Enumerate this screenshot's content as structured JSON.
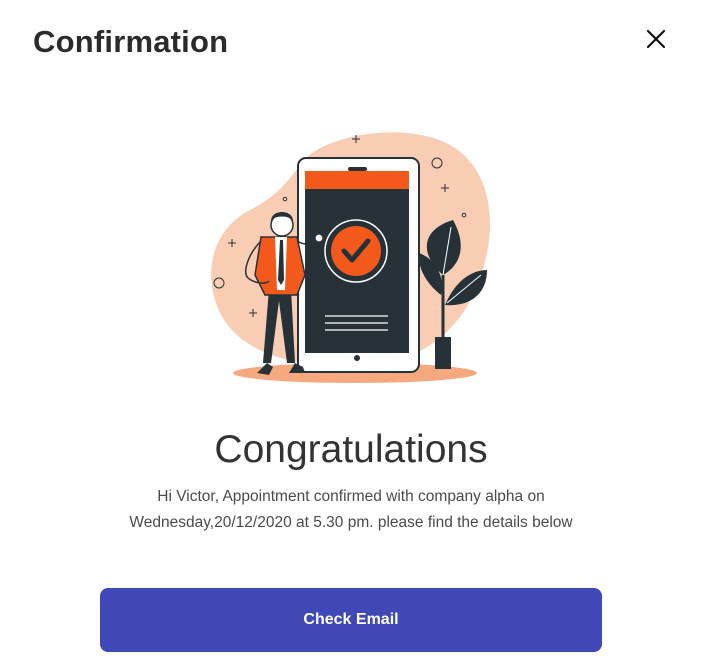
{
  "dialog": {
    "title": "Confirmation",
    "close_icon": "close-icon"
  },
  "illustration": {
    "name": "phone-confirmation-illustration",
    "colors": {
      "blob": "#f9cdb3",
      "accent": "#f2591b",
      "dark": "#263238"
    }
  },
  "content": {
    "heading": "Congratulations",
    "message_line1": "Hi Victor, Appointment confirmed with company alpha on",
    "message_line2": "Wednesday,20/12/2020 at 5.30 pm. please find the details below"
  },
  "actions": {
    "check_email_label": "Check Email"
  },
  "colors": {
    "primary": "#3f48b6",
    "title_text": "#2b2b2b",
    "body_text": "#4a4a4a"
  }
}
